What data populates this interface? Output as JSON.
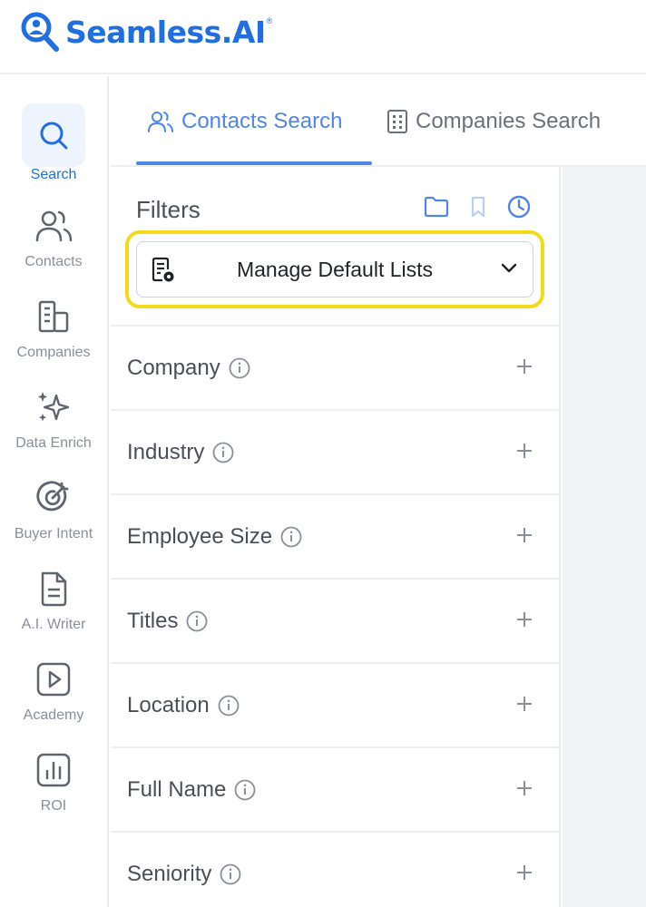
{
  "brand": {
    "name": "Seamless.AI",
    "registered_mark": "®",
    "color": "#1f6fe0"
  },
  "sidebar": {
    "items": [
      {
        "label": "Search",
        "icon": "search-icon",
        "active": true
      },
      {
        "label": "Contacts",
        "icon": "contacts-icon"
      },
      {
        "label": "Companies",
        "icon": "companies-icon"
      },
      {
        "label": "Data Enrich",
        "icon": "sparkles-icon"
      },
      {
        "label": "Buyer Intent",
        "icon": "target-icon"
      },
      {
        "label": "A.I. Writer",
        "icon": "document-icon"
      },
      {
        "label": "Academy",
        "icon": "play-icon"
      },
      {
        "label": "ROI",
        "icon": "bar-chart-icon"
      }
    ]
  },
  "tabs": [
    {
      "label": "Contacts Search",
      "icon": "users-icon",
      "active": true
    },
    {
      "label": "Companies Search",
      "icon": "building-icon",
      "active": false
    }
  ],
  "filters": {
    "title": "Filters",
    "actions": [
      "folder-icon",
      "bookmark-icon",
      "clock-icon"
    ],
    "default_lists": {
      "label": "Manage Default Lists",
      "icon": "list-settings-icon",
      "highlight_color": "#f2dc1a"
    },
    "rows": [
      {
        "label": "Company"
      },
      {
        "label": "Industry"
      },
      {
        "label": "Employee Size"
      },
      {
        "label": "Titles"
      },
      {
        "label": "Location"
      },
      {
        "label": "Full Name"
      },
      {
        "label": "Seniority"
      }
    ]
  }
}
